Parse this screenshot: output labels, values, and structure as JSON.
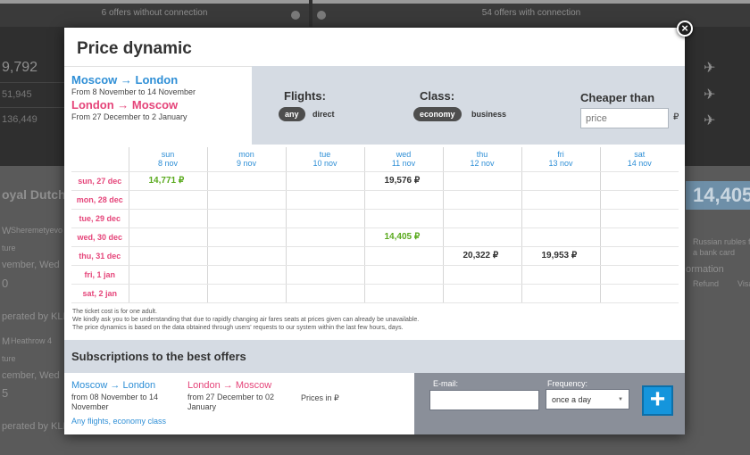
{
  "background": {
    "tab_left": "6 offers without connection",
    "tab_right": "54 offers with connection",
    "price_big": "9,792",
    "price_2": "51,945",
    "price_3": "136,449",
    "airline": "oyal Dutch",
    "featured_price": "14,405",
    "side_note": "Russian rubles f",
    "side_note2": "a bank card",
    "side_info": "ormation",
    "side_refund": "Refund",
    "side_visa": "Visa",
    "row1_code": "W",
    "row1_airport": "Sheremetyevo",
    "row1_dep": "ture",
    "row1_date": "vember, Wed",
    "row1_num": "0",
    "row1_op": "perated by KLM",
    "row2_code": "M",
    "row2_airport": "Heathrow 4",
    "row2_dep": "ture",
    "row2_date": "cember, Wed",
    "row2_num": "5",
    "row2_op": "perated by KLM"
  },
  "modal": {
    "title": "Price dynamic",
    "close_glyph": "×",
    "outbound": {
      "route": "Moscow → London",
      "dates": "From 8 November to 14 November"
    },
    "return": {
      "route": "London → Moscow",
      "dates": "From 27 December to 2 January"
    },
    "filters": {
      "flights_label": "Flights:",
      "flights_options": [
        "any",
        "direct"
      ],
      "flights_selected": "any",
      "class_label": "Class:",
      "class_options": [
        "economy",
        "business"
      ],
      "class_selected": "economy",
      "cheaper_label": "Cheaper than",
      "price_placeholder": "price",
      "currency": "₽"
    },
    "grid": {
      "columns": [
        {
          "day": "sun",
          "date": "8 nov"
        },
        {
          "day": "mon",
          "date": "9 nov"
        },
        {
          "day": "tue",
          "date": "10 nov"
        },
        {
          "day": "wed",
          "date": "11 nov"
        },
        {
          "day": "thu",
          "date": "12 nov"
        },
        {
          "day": "fri",
          "date": "13 nov"
        },
        {
          "day": "sat",
          "date": "14 nov"
        }
      ],
      "rows": [
        {
          "label": "sun, 27 dec",
          "cells": [
            "14,771 ₽",
            "",
            "",
            "19,576 ₽",
            "",
            "",
            ""
          ],
          "best": [
            0
          ]
        },
        {
          "label": "mon, 28 dec",
          "cells": [
            "",
            "",
            "",
            "",
            "",
            "",
            ""
          ],
          "best": []
        },
        {
          "label": "tue, 29 dec",
          "cells": [
            "",
            "",
            "",
            "",
            "",
            "",
            ""
          ],
          "best": []
        },
        {
          "label": "wed, 30 dec",
          "cells": [
            "",
            "",
            "",
            "14,405 ₽",
            "",
            "",
            ""
          ],
          "best": [
            3
          ]
        },
        {
          "label": "thu, 31 dec",
          "cells": [
            "",
            "",
            "",
            "",
            "20,322 ₽",
            "19,953 ₽",
            ""
          ],
          "best": []
        },
        {
          "label": "fri, 1 jan",
          "cells": [
            "",
            "",
            "",
            "",
            "",
            "",
            ""
          ],
          "best": []
        },
        {
          "label": "sat, 2 jan",
          "cells": [
            "",
            "",
            "",
            "",
            "",
            "",
            ""
          ],
          "best": []
        }
      ]
    },
    "notes": [
      "The ticket cost is for one adult.",
      "We kindly ask you to be understanding that due to rapidly changing air fares seats at prices given can already be unavailable.",
      "The price dynamics is based on the data obtained through users' requests to our system within the last few hours, days."
    ],
    "subscriptions": {
      "title": "Subscriptions to the best offers",
      "outbound_route": "Moscow → London",
      "outbound_dates": "from 08 November to 14 November",
      "return_route": "London → Moscow",
      "return_dates": "from 27 December to 02 January",
      "prices_in": "Prices in ₽",
      "filter_summary": "Any flights, economy class",
      "email_label": "E-mail:",
      "frequency_label": "Frequency:",
      "frequency_value": "once a day",
      "add_glyph": "+"
    }
  }
}
